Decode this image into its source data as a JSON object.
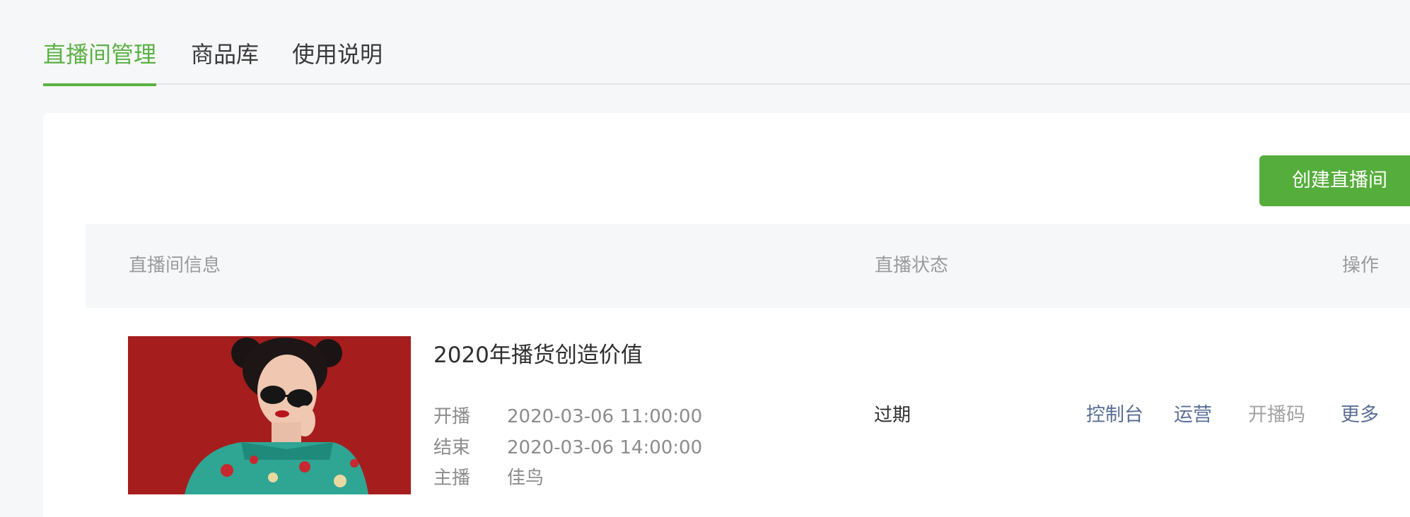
{
  "tabs": [
    {
      "label": "直播间管理",
      "active": true
    },
    {
      "label": "商品库",
      "active": false
    },
    {
      "label": "使用说明",
      "active": false
    }
  ],
  "toolbar": {
    "create_label": "创建直播间"
  },
  "table": {
    "headers": {
      "info": "直播间信息",
      "status": "直播状态",
      "ops": "操作"
    },
    "rows": [
      {
        "title": "2020年播货创造价值",
        "cover_icon": "cover-photo-woman-in-qipao-sunglasses",
        "meta": [
          {
            "label": "开播",
            "value": "2020-03-06 11:00:00"
          },
          {
            "label": "结束",
            "value": "2020-03-06 14:00:00"
          },
          {
            "label": "主播",
            "value": "佳鸟"
          }
        ],
        "status": "过期",
        "actions": [
          {
            "label": "控制台",
            "enabled": true
          },
          {
            "label": "运营",
            "enabled": true
          },
          {
            "label": "开播码",
            "enabled": false
          },
          {
            "label": "更多",
            "enabled": true
          }
        ]
      }
    ]
  },
  "colors": {
    "accent": "#5bb244",
    "button": "#55ad3b",
    "link": "#5a6f95",
    "disabled": "#a3a3a3",
    "page_bg": "#f6f7f9"
  }
}
